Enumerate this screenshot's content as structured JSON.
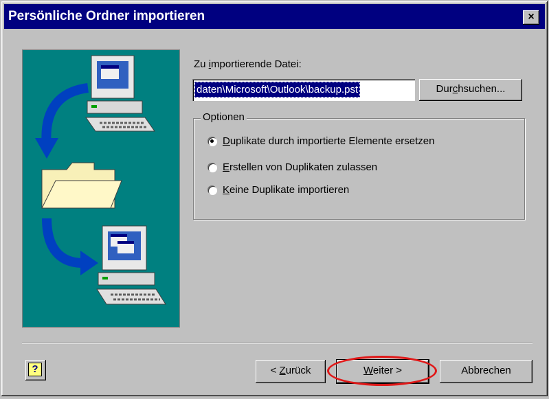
{
  "window": {
    "title": "Persönliche Ordner importieren",
    "close_label": "×"
  },
  "file": {
    "label_prefix": "Zu ",
    "label_underline": "i",
    "label_suffix": "mportierende Datei:",
    "value": "daten\\Microsoft\\Outlook\\backup.pst",
    "browse_prefix": "Dur",
    "browse_underline": "c",
    "browse_suffix": "hsuchen..."
  },
  "options": {
    "legend": "Optionen",
    "items": [
      {
        "underline": "D",
        "rest": "uplikate durch importierte Elemente ersetzen",
        "selected": true
      },
      {
        "underline": "E",
        "rest": "rstellen von Duplikaten zulassen",
        "selected": false
      },
      {
        "underline": "K",
        "rest": "eine Duplikate importieren",
        "selected": false
      }
    ]
  },
  "footer": {
    "help_label": "?",
    "back_prefix": "< ",
    "back_underline": "Z",
    "back_suffix": "urück",
    "next_underline": "W",
    "next_suffix": "eiter >",
    "cancel_label": "Abbrechen"
  },
  "colors": {
    "titlebar": "#000080",
    "illustration_bg": "#008080",
    "highlight_ring": "#e01818"
  },
  "icons": [
    "computer-icon",
    "folder-icon",
    "arrow-icon",
    "help-icon",
    "close-icon"
  ]
}
